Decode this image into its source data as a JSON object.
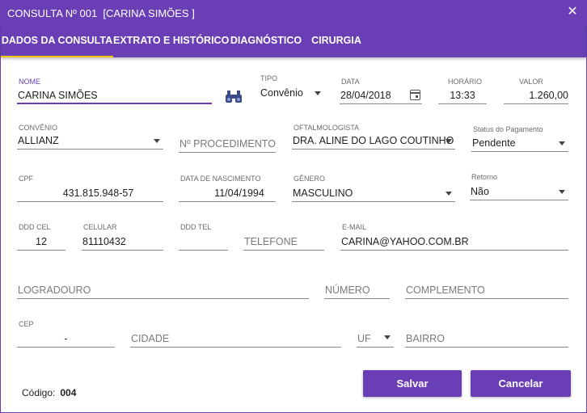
{
  "window": {
    "title": "CONSULTA Nº 001  [CARINA SIMÕES ]",
    "close_glyph": "✕"
  },
  "tabs": [
    {
      "label": "DADOS DA CONSULTA",
      "active": true
    },
    {
      "label": "EXTRATO E HISTÓRICO",
      "active": false
    },
    {
      "label": "DIAGNÓSTICO",
      "active": false
    },
    {
      "label": "CIRURGIA",
      "active": false
    }
  ],
  "form": {
    "nome": {
      "label": "NOME",
      "value": "CARINA SIMÕES"
    },
    "tipo": {
      "label": "TIPO",
      "value": "Convênio"
    },
    "data": {
      "label": "DATA",
      "value": "28/04/2018"
    },
    "horario": {
      "label": "HORÁRIO",
      "value": "13:33"
    },
    "valor": {
      "label": "VALOR",
      "value": "1.260,00"
    },
    "convenio": {
      "label": "CONVÊNIO",
      "value": "ALLIANZ"
    },
    "procedimento": {
      "placeholder": "Nº PROCEDIMENTO"
    },
    "oftalmologista": {
      "label": "OFTALMOLOGISTA",
      "value": "DRA. ALINE DO LAGO COUTINHO"
    },
    "status_pagamento": {
      "label": "Status do Pagamento",
      "value": "Pendente"
    },
    "cpf": {
      "label": "CPF",
      "value": "431.815.948-57"
    },
    "nascimento": {
      "label": "DATA DE NASCIMENTO",
      "value": "11/04/1994"
    },
    "genero": {
      "label": "GÊNERO",
      "value": "MASCULINO"
    },
    "retorno": {
      "label": "Retorno",
      "value": "Não"
    },
    "ddd_cel": {
      "label": "DDD CEL",
      "value": "12"
    },
    "celular": {
      "label": "CELULAR",
      "value": "81110432"
    },
    "ddd_tel": {
      "label": "DDD TEL",
      "value": ""
    },
    "telefone": {
      "placeholder": "TELEFONE"
    },
    "email": {
      "label": "E-MAIL",
      "value": "CARINA@YAHOO.COM.BR"
    },
    "logradouro": {
      "placeholder": "LOGRADOURO"
    },
    "numero": {
      "placeholder": "NÚMERO"
    },
    "complemento": {
      "placeholder": "COMPLEMENTO"
    },
    "cep": {
      "label": "CEP",
      "value": "-"
    },
    "cidade": {
      "placeholder": "CIDADE"
    },
    "uf": {
      "placeholder": "UF"
    },
    "bairro": {
      "placeholder": "BAIRRO"
    }
  },
  "footer": {
    "codigo_label": "Código:",
    "codigo_value": "004",
    "save_label": "Salvar",
    "cancel_label": "Cancelar"
  },
  "colors": {
    "accent": "#6a3fb5",
    "tab_indicator": "#f5c400"
  },
  "icons": [
    "close-icon",
    "binoculars-icon",
    "calendar-icon",
    "dropdown-arrow-icon"
  ]
}
